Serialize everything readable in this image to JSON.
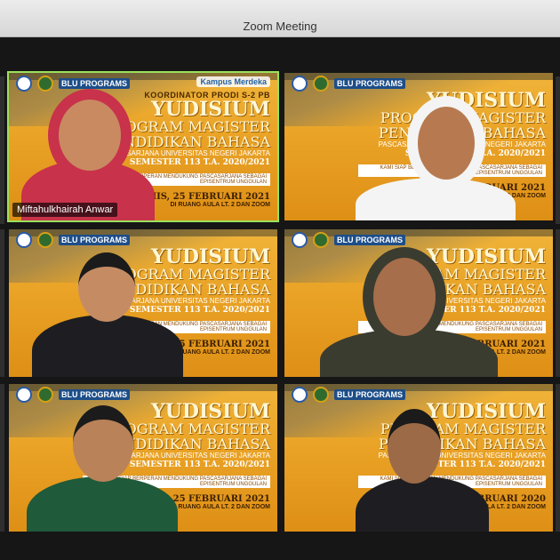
{
  "window": {
    "title": "Zoom Meeting"
  },
  "slide": {
    "coordinator": "KOORDINATOR PRODI S-2 PB",
    "title": "YUDISIUM",
    "program": "PROGRAM MAGISTER",
    "program2": "PENDIDIKAN BAHASA",
    "school": "PASCASARJANA UNIVERSITAS NEGERI JAKARTA",
    "semester": "SEMESTER 113 T.A. 2020/2021",
    "tagline": "KAMI SIAP BERPERAN MENDUKUNG PASCASARJANA SEBAGAI EPISENTRUM UNGGULAN",
    "date": "KAMIS, 25 FEBRUARI 2021",
    "date_alt": "25 FEBRUARI 2020",
    "place": "DI RUANG AULA LT. 2 DAN ZOOM",
    "blu": "BLU PROGRAMS",
    "kampus": "Kampus Merdeka"
  },
  "participants": [
    {
      "name": "Miftahulkhairah Anwar",
      "active": true,
      "hijab": "#c8324a",
      "skin": "#c98a62"
    },
    {
      "name": "",
      "active": false,
      "hijab": "#f4f4f4",
      "skin": "#b77a50"
    },
    {
      "name": "",
      "active": false,
      "hijab": "",
      "skin": "#c58c64"
    },
    {
      "name": "",
      "active": false,
      "hijab": "#3a3c30",
      "skin": "#a66e4a"
    },
    {
      "name": "",
      "active": false,
      "hijab": "",
      "skin": "#b98258"
    },
    {
      "name": "",
      "active": false,
      "hijab": "",
      "skin": "#9c6a46"
    }
  ],
  "colors": {
    "active_border": "#9be15d",
    "slide_bg": "#e9a225",
    "titlebar": "#e0e0e0"
  }
}
